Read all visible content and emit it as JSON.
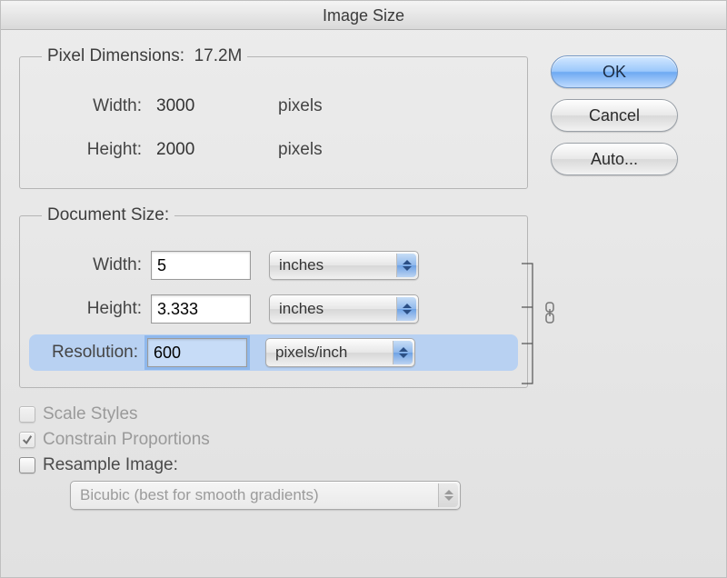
{
  "title": "Image Size",
  "buttons": {
    "ok": "OK",
    "cancel": "Cancel",
    "auto": "Auto..."
  },
  "pixel_dimensions": {
    "legend": "Pixel Dimensions:",
    "size": "17.2M",
    "width_label": "Width:",
    "width_value": "3000",
    "width_unit": "pixels",
    "height_label": "Height:",
    "height_value": "2000",
    "height_unit": "pixels"
  },
  "document_size": {
    "legend": "Document Size:",
    "width_label": "Width:",
    "width_value": "5",
    "width_unit": "inches",
    "height_label": "Height:",
    "height_value": "3.333",
    "height_unit": "inches",
    "resolution_label": "Resolution:",
    "resolution_value": "600",
    "resolution_unit": "pixels/inch"
  },
  "options": {
    "scale_styles_label": "Scale Styles",
    "scale_styles_checked": false,
    "scale_styles_enabled": false,
    "constrain_label": "Constrain Proportions",
    "constrain_checked": true,
    "constrain_enabled": false,
    "resample_label": "Resample Image:",
    "resample_checked": false,
    "resample_enabled": true,
    "resample_method": "Bicubic (best for smooth gradients)"
  }
}
